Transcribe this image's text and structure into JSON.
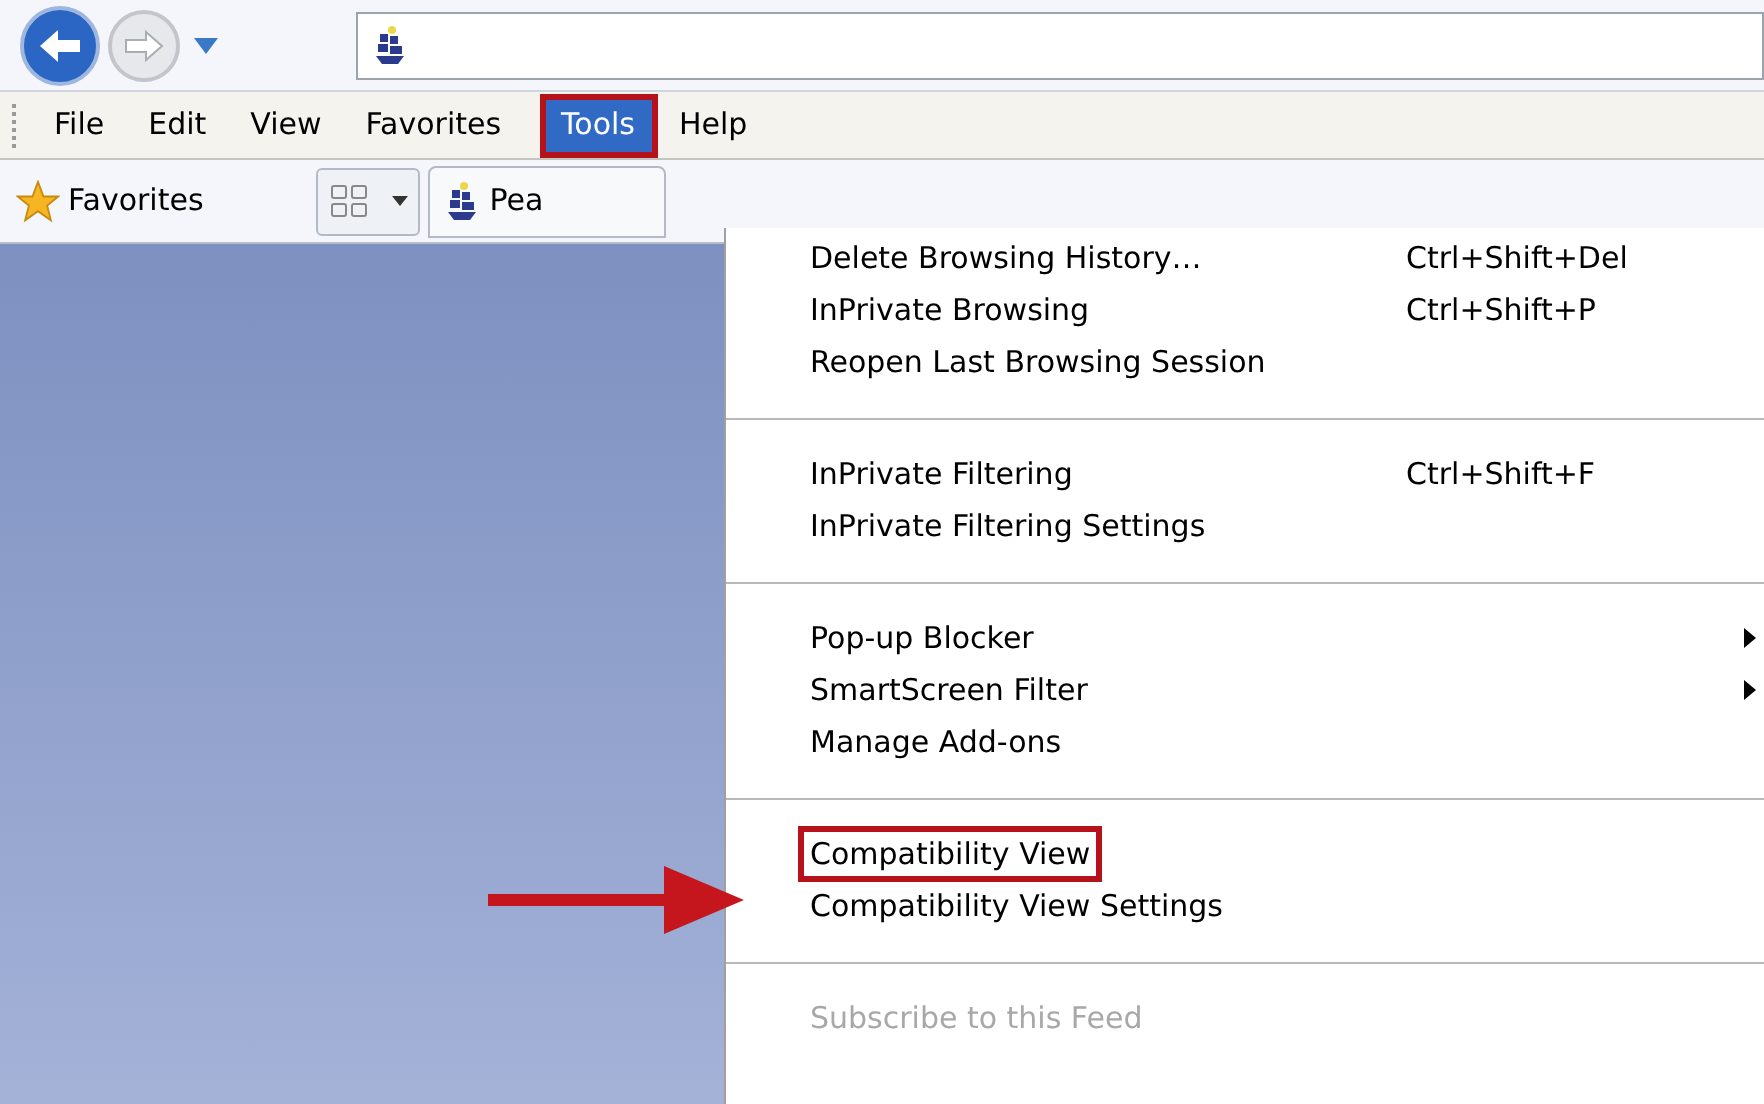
{
  "menu_bar": [
    {
      "label": "File",
      "selected": false,
      "outlined": false
    },
    {
      "label": "Edit",
      "selected": false,
      "outlined": false
    },
    {
      "label": "View",
      "selected": false,
      "outlined": false
    },
    {
      "label": "Favorites",
      "selected": false,
      "outlined": false
    },
    {
      "label": "Tools",
      "selected": true,
      "outlined": true
    },
    {
      "label": "Help",
      "selected": false,
      "outlined": false
    }
  ],
  "favorites_bar": {
    "favorites_label": "Favorites",
    "tab_label": "Pea"
  },
  "tools_menu": [
    {
      "kind": "item",
      "label": "Delete Browsing History…",
      "shortcut": "Ctrl+Shift+Del",
      "submenu": false,
      "disabled": false,
      "outlined": false
    },
    {
      "kind": "item",
      "label": "InPrivate Browsing",
      "shortcut": "Ctrl+Shift+P",
      "submenu": false,
      "disabled": false,
      "outlined": false
    },
    {
      "kind": "item",
      "label": "Reopen Last Browsing Session",
      "submenu": false,
      "disabled": false,
      "outlined": false
    },
    {
      "kind": "separator"
    },
    {
      "kind": "item",
      "label": "InPrivate Filtering",
      "shortcut": "Ctrl+Shift+F",
      "submenu": false,
      "disabled": false,
      "outlined": false
    },
    {
      "kind": "item",
      "label": "InPrivate Filtering Settings",
      "submenu": false,
      "disabled": false,
      "outlined": false
    },
    {
      "kind": "separator"
    },
    {
      "kind": "item",
      "label": "Pop-up Blocker",
      "submenu": true,
      "disabled": false,
      "outlined": false
    },
    {
      "kind": "item",
      "label": "SmartScreen Filter",
      "submenu": true,
      "disabled": false,
      "outlined": false
    },
    {
      "kind": "item",
      "label": "Manage Add-ons",
      "submenu": false,
      "disabled": false,
      "outlined": false
    },
    {
      "kind": "separator"
    },
    {
      "kind": "item",
      "label": "Compatibility View",
      "submenu": false,
      "disabled": false,
      "outlined": true
    },
    {
      "kind": "item",
      "label": "Compatibility View Settings",
      "submenu": false,
      "disabled": false,
      "outlined": false
    },
    {
      "kind": "separator"
    },
    {
      "kind": "item",
      "label": "Subscribe to this Feed",
      "submenu": false,
      "disabled": true,
      "outlined": false
    }
  ]
}
